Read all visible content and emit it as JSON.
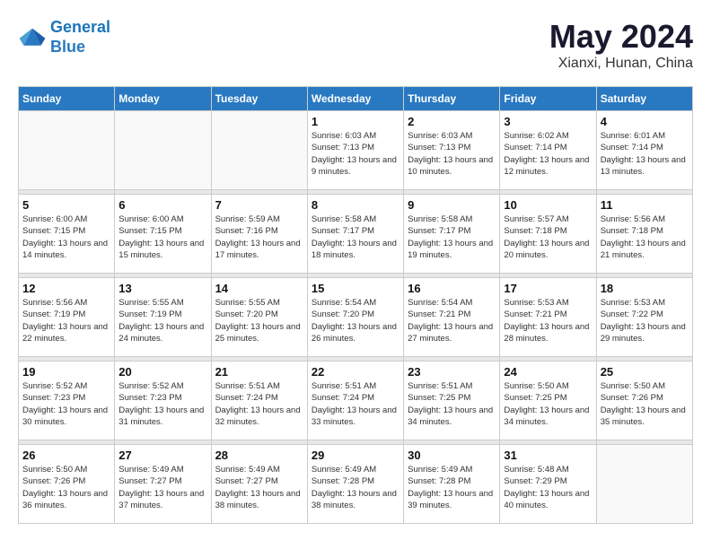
{
  "header": {
    "logo_line1": "General",
    "logo_line2": "Blue",
    "month": "May 2024",
    "location": "Xianxi, Hunan, China"
  },
  "weekdays": [
    "Sunday",
    "Monday",
    "Tuesday",
    "Wednesday",
    "Thursday",
    "Friday",
    "Saturday"
  ],
  "weeks": [
    [
      {
        "day": "",
        "sunrise": "",
        "sunset": "",
        "daylight": ""
      },
      {
        "day": "",
        "sunrise": "",
        "sunset": "",
        "daylight": ""
      },
      {
        "day": "",
        "sunrise": "",
        "sunset": "",
        "daylight": ""
      },
      {
        "day": "1",
        "sunrise": "Sunrise: 6:03 AM",
        "sunset": "Sunset: 7:13 PM",
        "daylight": "Daylight: 13 hours and 9 minutes."
      },
      {
        "day": "2",
        "sunrise": "Sunrise: 6:03 AM",
        "sunset": "Sunset: 7:13 PM",
        "daylight": "Daylight: 13 hours and 10 minutes."
      },
      {
        "day": "3",
        "sunrise": "Sunrise: 6:02 AM",
        "sunset": "Sunset: 7:14 PM",
        "daylight": "Daylight: 13 hours and 12 minutes."
      },
      {
        "day": "4",
        "sunrise": "Sunrise: 6:01 AM",
        "sunset": "Sunset: 7:14 PM",
        "daylight": "Daylight: 13 hours and 13 minutes."
      }
    ],
    [
      {
        "day": "5",
        "sunrise": "Sunrise: 6:00 AM",
        "sunset": "Sunset: 7:15 PM",
        "daylight": "Daylight: 13 hours and 14 minutes."
      },
      {
        "day": "6",
        "sunrise": "Sunrise: 6:00 AM",
        "sunset": "Sunset: 7:15 PM",
        "daylight": "Daylight: 13 hours and 15 minutes."
      },
      {
        "day": "7",
        "sunrise": "Sunrise: 5:59 AM",
        "sunset": "Sunset: 7:16 PM",
        "daylight": "Daylight: 13 hours and 17 minutes."
      },
      {
        "day": "8",
        "sunrise": "Sunrise: 5:58 AM",
        "sunset": "Sunset: 7:17 PM",
        "daylight": "Daylight: 13 hours and 18 minutes."
      },
      {
        "day": "9",
        "sunrise": "Sunrise: 5:58 AM",
        "sunset": "Sunset: 7:17 PM",
        "daylight": "Daylight: 13 hours and 19 minutes."
      },
      {
        "day": "10",
        "sunrise": "Sunrise: 5:57 AM",
        "sunset": "Sunset: 7:18 PM",
        "daylight": "Daylight: 13 hours and 20 minutes."
      },
      {
        "day": "11",
        "sunrise": "Sunrise: 5:56 AM",
        "sunset": "Sunset: 7:18 PM",
        "daylight": "Daylight: 13 hours and 21 minutes."
      }
    ],
    [
      {
        "day": "12",
        "sunrise": "Sunrise: 5:56 AM",
        "sunset": "Sunset: 7:19 PM",
        "daylight": "Daylight: 13 hours and 22 minutes."
      },
      {
        "day": "13",
        "sunrise": "Sunrise: 5:55 AM",
        "sunset": "Sunset: 7:19 PM",
        "daylight": "Daylight: 13 hours and 24 minutes."
      },
      {
        "day": "14",
        "sunrise": "Sunrise: 5:55 AM",
        "sunset": "Sunset: 7:20 PM",
        "daylight": "Daylight: 13 hours and 25 minutes."
      },
      {
        "day": "15",
        "sunrise": "Sunrise: 5:54 AM",
        "sunset": "Sunset: 7:20 PM",
        "daylight": "Daylight: 13 hours and 26 minutes."
      },
      {
        "day": "16",
        "sunrise": "Sunrise: 5:54 AM",
        "sunset": "Sunset: 7:21 PM",
        "daylight": "Daylight: 13 hours and 27 minutes."
      },
      {
        "day": "17",
        "sunrise": "Sunrise: 5:53 AM",
        "sunset": "Sunset: 7:21 PM",
        "daylight": "Daylight: 13 hours and 28 minutes."
      },
      {
        "day": "18",
        "sunrise": "Sunrise: 5:53 AM",
        "sunset": "Sunset: 7:22 PM",
        "daylight": "Daylight: 13 hours and 29 minutes."
      }
    ],
    [
      {
        "day": "19",
        "sunrise": "Sunrise: 5:52 AM",
        "sunset": "Sunset: 7:23 PM",
        "daylight": "Daylight: 13 hours and 30 minutes."
      },
      {
        "day": "20",
        "sunrise": "Sunrise: 5:52 AM",
        "sunset": "Sunset: 7:23 PM",
        "daylight": "Daylight: 13 hours and 31 minutes."
      },
      {
        "day": "21",
        "sunrise": "Sunrise: 5:51 AM",
        "sunset": "Sunset: 7:24 PM",
        "daylight": "Daylight: 13 hours and 32 minutes."
      },
      {
        "day": "22",
        "sunrise": "Sunrise: 5:51 AM",
        "sunset": "Sunset: 7:24 PM",
        "daylight": "Daylight: 13 hours and 33 minutes."
      },
      {
        "day": "23",
        "sunrise": "Sunrise: 5:51 AM",
        "sunset": "Sunset: 7:25 PM",
        "daylight": "Daylight: 13 hours and 34 minutes."
      },
      {
        "day": "24",
        "sunrise": "Sunrise: 5:50 AM",
        "sunset": "Sunset: 7:25 PM",
        "daylight": "Daylight: 13 hours and 34 minutes."
      },
      {
        "day": "25",
        "sunrise": "Sunrise: 5:50 AM",
        "sunset": "Sunset: 7:26 PM",
        "daylight": "Daylight: 13 hours and 35 minutes."
      }
    ],
    [
      {
        "day": "26",
        "sunrise": "Sunrise: 5:50 AM",
        "sunset": "Sunset: 7:26 PM",
        "daylight": "Daylight: 13 hours and 36 minutes."
      },
      {
        "day": "27",
        "sunrise": "Sunrise: 5:49 AM",
        "sunset": "Sunset: 7:27 PM",
        "daylight": "Daylight: 13 hours and 37 minutes."
      },
      {
        "day": "28",
        "sunrise": "Sunrise: 5:49 AM",
        "sunset": "Sunset: 7:27 PM",
        "daylight": "Daylight: 13 hours and 38 minutes."
      },
      {
        "day": "29",
        "sunrise": "Sunrise: 5:49 AM",
        "sunset": "Sunset: 7:28 PM",
        "daylight": "Daylight: 13 hours and 38 minutes."
      },
      {
        "day": "30",
        "sunrise": "Sunrise: 5:49 AM",
        "sunset": "Sunset: 7:28 PM",
        "daylight": "Daylight: 13 hours and 39 minutes."
      },
      {
        "day": "31",
        "sunrise": "Sunrise: 5:48 AM",
        "sunset": "Sunset: 7:29 PM",
        "daylight": "Daylight: 13 hours and 40 minutes."
      },
      {
        "day": "",
        "sunrise": "",
        "sunset": "",
        "daylight": ""
      }
    ]
  ]
}
